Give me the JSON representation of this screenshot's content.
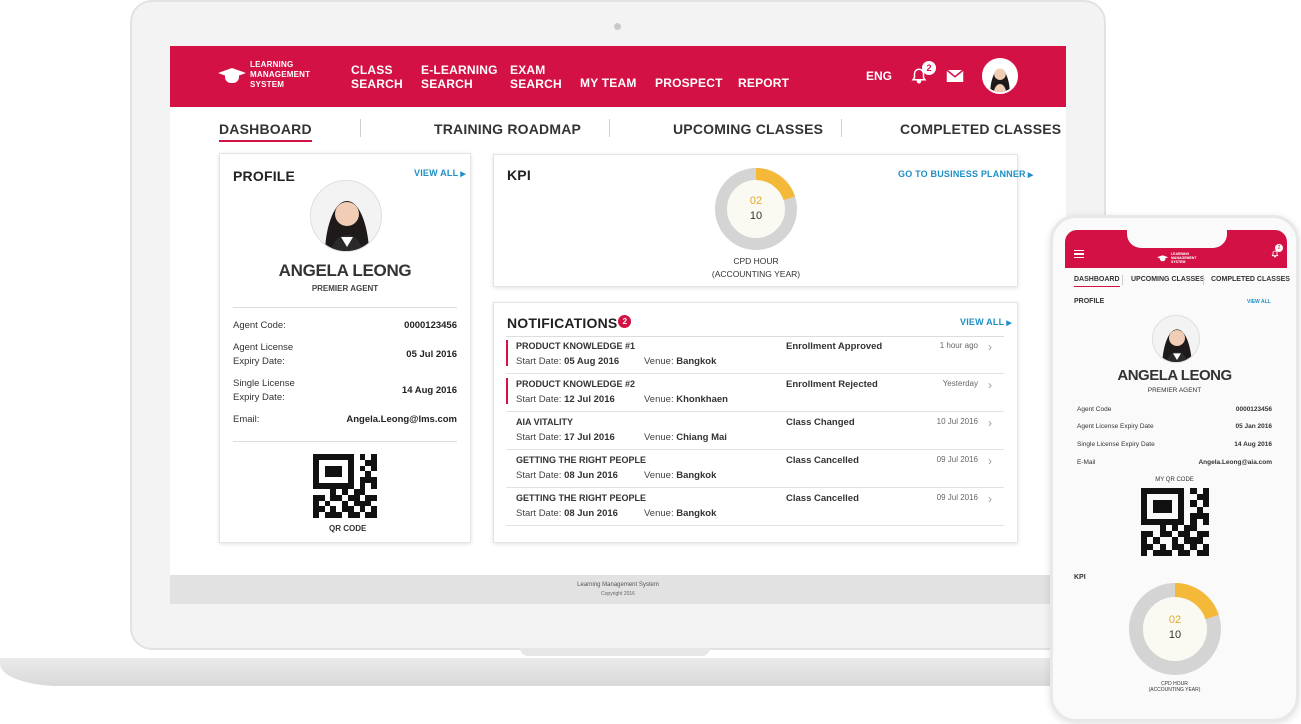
{
  "app": {
    "logo_line1": "LEARNING",
    "logo_line2": "MANAGEMENT",
    "logo_line3": "SYSTEM"
  },
  "nav": {
    "items": [
      {
        "line1": "CLASS",
        "line2": "SEARCH"
      },
      {
        "line1": "E-LEARNING",
        "line2": "SEARCH"
      },
      {
        "line1": "EXAM",
        "line2": "SEARCH"
      },
      {
        "line1": "MY TEAM",
        "line2": ""
      },
      {
        "line1": "PROSPECT",
        "line2": ""
      },
      {
        "line1": "REPORT",
        "line2": ""
      }
    ],
    "language": "ENG",
    "notification_count": "2"
  },
  "tabs": [
    "DASHBOARD",
    "TRAINING ROADMAP",
    "UPCOMING CLASSES",
    "COMPLETED CLASSES"
  ],
  "profile": {
    "title": "PROFILE",
    "view_all": "VIEW ALL",
    "name": "ANGELA LEONG",
    "role": "PREMIER AGENT",
    "fields": [
      {
        "label_line1": "Agent Code:",
        "label_line2": "",
        "value": "0000123456"
      },
      {
        "label_line1": "Agent License",
        "label_line2": "Expiry Date:",
        "value": "05 Jul 2016"
      },
      {
        "label_line1": "Single License",
        "label_line2": "Expiry Date:",
        "value": "14 Aug 2016"
      },
      {
        "label_line1": "Email:",
        "label_line2": "",
        "value": "Angela.Leong@lms.com"
      }
    ],
    "qr_label": "QR CODE"
  },
  "kpi": {
    "title": "KPI",
    "link": "GO TO BUSINESS PLANNER",
    "completed": "02",
    "target": "10",
    "fraction": 0.2,
    "caption_line1": "CPD HOUR",
    "caption_line2": "(ACCOUNTING YEAR)",
    "colors": {
      "progress": "#f5b93a",
      "track": "#d4d4d4",
      "center": "#fafaf2"
    }
  },
  "notifications": {
    "title": "NOTIFICATIONS",
    "count": "2",
    "view_all": "VIEW ALL",
    "start_date_label": "Start Date:",
    "venue_label": "Venue:",
    "items": [
      {
        "title": "PRODUCT KNOWLEDGE #1",
        "start_date": "05 Aug 2016",
        "venue": "Bangkok",
        "status": "Enrollment Approved",
        "time": "1 hour ago",
        "flag": true
      },
      {
        "title": "PRODUCT KNOWLEDGE #2",
        "start_date": "12 Jul 2016",
        "venue": "Khonkhaen",
        "status": "Enrollment Rejected",
        "time": "Yesterday",
        "flag": true
      },
      {
        "title": "AIA VITALITY",
        "start_date": "17 Jul 2016",
        "venue": "Chiang Mai",
        "status": "Class Changed",
        "time": "10 Jul 2016",
        "flag": false
      },
      {
        "title": "GETTING THE RIGHT PEOPLE",
        "start_date": "08 Jun 2016",
        "venue": "Bangkok",
        "status": "Class Cancelled",
        "time": "09 Jul 2016",
        "flag": false
      },
      {
        "title": "GETTING THE RIGHT PEOPLE",
        "start_date": "08 Jun 2016",
        "venue": "Bangkok",
        "status": "Class Cancelled",
        "time": "09 Jul 2016",
        "flag": false
      }
    ]
  },
  "footer": {
    "line1": "Learning Management System",
    "line2": "Copyright 2016"
  },
  "mobile": {
    "tabs": [
      "DASHBOARD",
      "UPCOMING CLASSES",
      "COMPLETED CLASSES"
    ],
    "profile_title": "PROFILE",
    "view_all": "VIEW ALL",
    "name": "ANGELA LEONG",
    "role": "PREMIER AGENT",
    "fields": [
      {
        "label": "Agent Code",
        "value": "0000123456"
      },
      {
        "label": "Agent License Expiry Date",
        "value": "05 Jan 2016"
      },
      {
        "label": "Single License Expiry Date",
        "value": "14 Aug 2016"
      },
      {
        "label": "E-Mail",
        "value": "Angela.Leong@aia.com"
      }
    ],
    "qr_label": "MY QR CODE",
    "kpi_title": "KPI",
    "kpi_completed": "02",
    "kpi_target": "10",
    "kpi_caption_line1": "CPD HOUR",
    "kpi_caption_line2": "(ACCOUNTING YEAR)",
    "notification_count": "2"
  },
  "colors": {
    "brand": "#d31145",
    "link": "#1e8fc6"
  }
}
